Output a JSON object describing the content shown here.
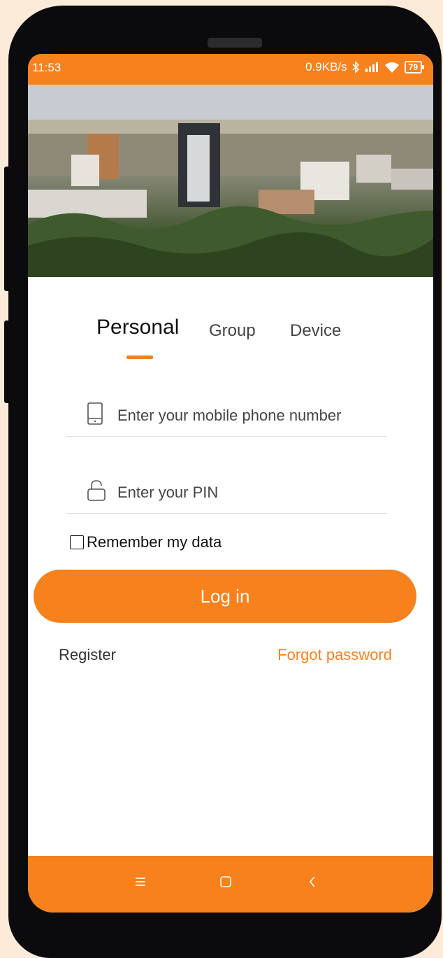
{
  "status_bar": {
    "time": "11:53",
    "net_speed": "0.9KB/s",
    "battery": "79"
  },
  "tabs": [
    "Personal",
    "Group",
    "Device"
  ],
  "active_tab": "Personal",
  "phone_field": {
    "placeholder": "Enter your mobile phone number"
  },
  "pin_field": {
    "placeholder": "Enter your PIN"
  },
  "remember_label": "Remember my data",
  "login_label": "Log in",
  "register_label": "Register",
  "forgot_label": "Forgot password",
  "colors": {
    "accent": "#f7811c",
    "background": "#fdebd9"
  },
  "nav": {
    "icons": [
      "menu-icon",
      "home-square-icon",
      "back-chevron-icon"
    ]
  }
}
